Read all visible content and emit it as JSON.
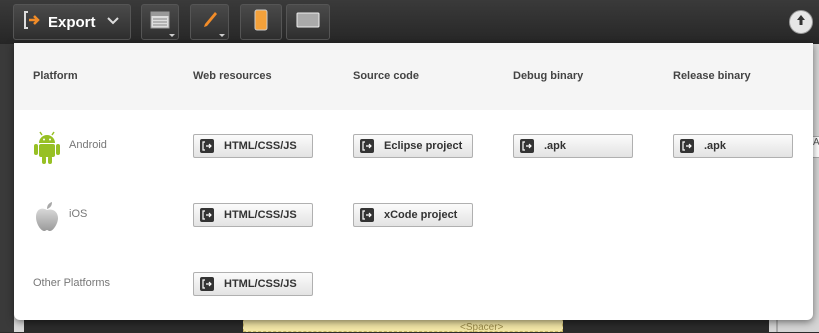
{
  "toolbar": {
    "export_label": "Export"
  },
  "background": {
    "spacer_text": "<Spacer>",
    "right_input_text": "A"
  },
  "panel": {
    "headers": {
      "platform": "Platform",
      "web": "Web resources",
      "source": "Source code",
      "debug": "Debug binary",
      "release": "Release binary"
    },
    "rows": {
      "android": {
        "label": "Android",
        "web": "HTML/CSS/JS",
        "source": "Eclipse project",
        "debug": ".apk",
        "release": ".apk"
      },
      "ios": {
        "label": "iOS",
        "web": "HTML/CSS/JS",
        "source": "xCode project"
      },
      "other": {
        "label": "Other Platforms",
        "web": "HTML/CSS/JS"
      }
    }
  },
  "colors": {
    "accent": "#f28c28",
    "android_green": "#97c024"
  }
}
